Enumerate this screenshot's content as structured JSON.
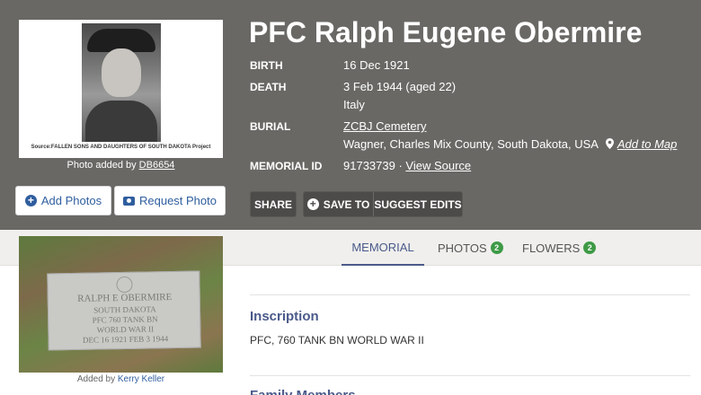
{
  "memorial": {
    "name": "PFC Ralph Eugene Obermire",
    "birth": {
      "label": "BIRTH",
      "value": "16 Dec 1921"
    },
    "death": {
      "label": "DEATH",
      "value": "3 Feb 1944 (aged 22)",
      "place": "Italy"
    },
    "burial": {
      "label": "BURIAL",
      "cemetery": "ZCBJ Cemetery",
      "location": "Wagner, Charles Mix County, South Dakota, USA",
      "add_to_map": "Add to Map"
    },
    "memorial_id": {
      "label": "MEMORIAL ID",
      "value": "91733739",
      "separator": " · ",
      "view_source": "View Source"
    }
  },
  "portrait": {
    "caption": "Source:FALLEN SONS AND DAUGHTERS OF SOUTH DAKOTA Project",
    "added_prefix": "Photo added by ",
    "added_by": "DB6654"
  },
  "photo_buttons": {
    "add": "Add Photos",
    "request": "Request Photo"
  },
  "actions": {
    "share": "SHARE",
    "save_to": "SAVE TO",
    "suggest_edits": "SUGGEST EDITS"
  },
  "tabs": [
    {
      "label": "MEMORIAL",
      "active": true
    },
    {
      "label": "PHOTOS",
      "count": "2"
    },
    {
      "label": "FLOWERS",
      "count": "2"
    }
  ],
  "gravestone": {
    "lines": [
      "RALPH E OBERMIRE",
      "SOUTH DAKOTA",
      "PFC 760 TANK BN",
      "WORLD WAR II",
      "DEC 16 1921   FEB 3 1944"
    ],
    "added_prefix": "Added by ",
    "added_by": "Kerry Keller"
  },
  "inscription": {
    "title": "Inscription",
    "text": "PFC, 760 TANK BN WORLD WAR II"
  },
  "next_section": {
    "title": "Family Members"
  },
  "colors": {
    "hero": "#6a6865",
    "accent": "#4a5a8a",
    "link": "#2f5e9e",
    "badge": "#3e9a45"
  }
}
